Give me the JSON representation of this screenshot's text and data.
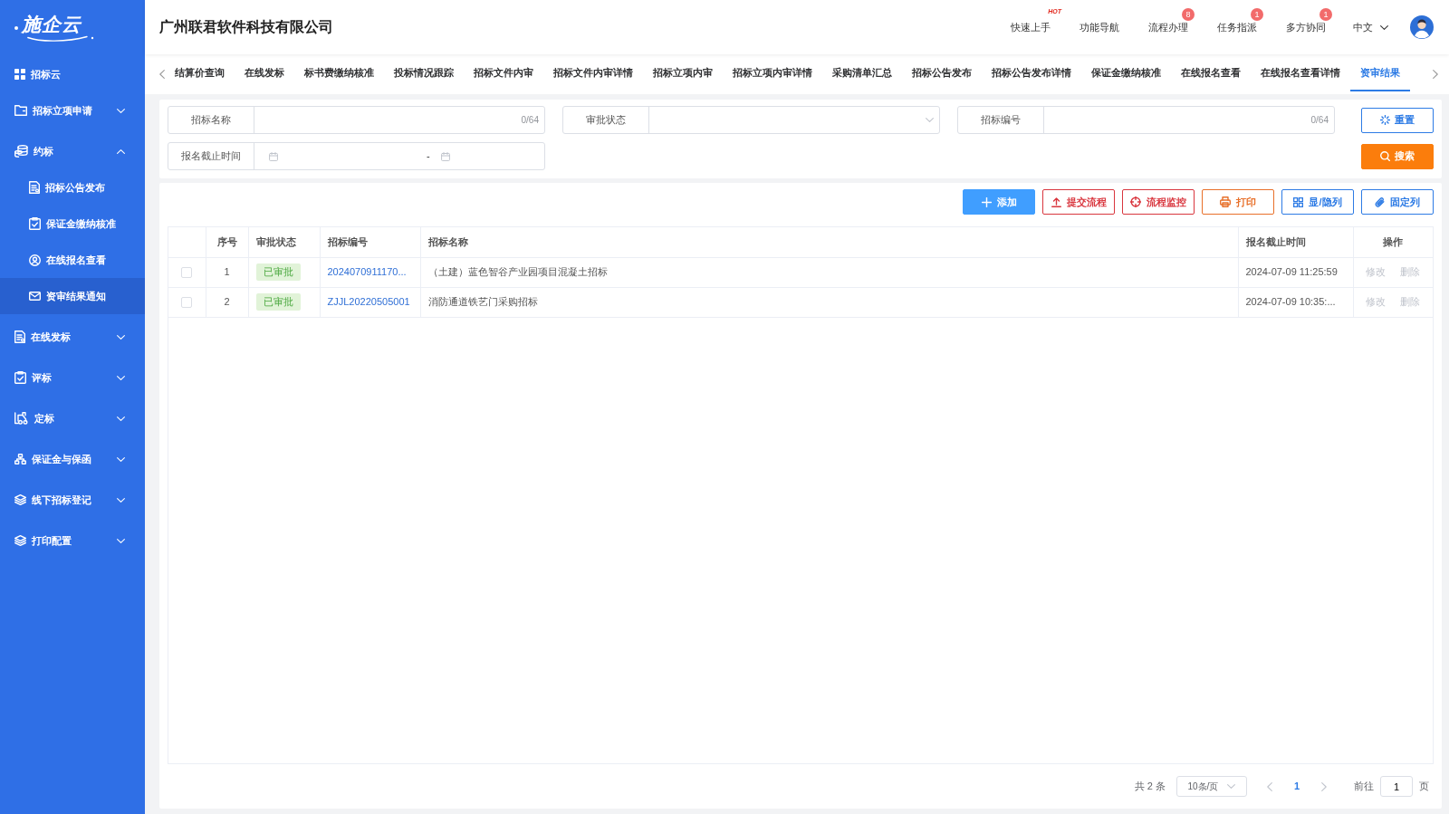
{
  "sidebar": {
    "logo": "施企云",
    "items": [
      {
        "label": "招标云",
        "selected": false
      },
      {
        "label": "招标立项申请",
        "expanded": false,
        "selected": false
      },
      {
        "label": "约标",
        "expanded": true,
        "selected": false,
        "children": [
          {
            "label": "招标公告发布",
            "selected": false
          },
          {
            "label": "保证金缴纳核准",
            "selected": false
          },
          {
            "label": "在线报名查看",
            "selected": false
          },
          {
            "label": "资审结果通知",
            "selected": true
          }
        ]
      },
      {
        "label": "在线发标",
        "expanded": false,
        "selected": false
      },
      {
        "label": "评标",
        "expanded": false,
        "selected": false
      },
      {
        "label": "定标",
        "expanded": false,
        "selected": false
      },
      {
        "label": "保证金与保函",
        "expanded": false,
        "selected": false
      },
      {
        "label": "线下招标登记",
        "expanded": false,
        "selected": false
      },
      {
        "label": "打印配置",
        "expanded": false,
        "selected": false
      }
    ]
  },
  "header": {
    "company": "广州联君软件科技有限公司",
    "nav": [
      {
        "label": "快速上手",
        "tag": "HOT"
      },
      {
        "label": "功能导航"
      },
      {
        "label": "流程办理",
        "badge": "8"
      },
      {
        "label": "任务指派",
        "badge": "1"
      },
      {
        "label": "多方协同",
        "badge": "1"
      }
    ],
    "language": "中文"
  },
  "tabs": [
    {
      "label": "结算价查询",
      "selected": false
    },
    {
      "label": "在线发标",
      "selected": false
    },
    {
      "label": "标书费缴纳核准",
      "selected": false
    },
    {
      "label": "投标情况跟踪",
      "selected": false
    },
    {
      "label": "招标文件内审",
      "selected": false
    },
    {
      "label": "招标文件内审详情",
      "selected": false
    },
    {
      "label": "招标立项内审",
      "selected": false
    },
    {
      "label": "招标立项内审详情",
      "selected": false
    },
    {
      "label": "采购清单汇总",
      "selected": false
    },
    {
      "label": "招标公告发布",
      "selected": false
    },
    {
      "label": "招标公告发布详情",
      "selected": false
    },
    {
      "label": "保证金缴纳核准",
      "selected": false
    },
    {
      "label": "在线报名查看",
      "selected": false
    },
    {
      "label": "在线报名查看详情",
      "selected": false
    },
    {
      "label": "资审结果",
      "selected": true
    }
  ],
  "filters": {
    "fields": [
      {
        "kind": "text",
        "label": "招标名称",
        "counter": "0/64"
      },
      {
        "kind": "select",
        "label": "审批状态"
      },
      {
        "kind": "text",
        "label": "招标编号",
        "counter": "0/64"
      },
      {
        "kind": "daterange",
        "label": "报名截止时间",
        "separator": "-"
      }
    ],
    "reset_button": "重置",
    "search_button": "搜索"
  },
  "toolbar": [
    {
      "kind": "primary",
      "label": "添加"
    },
    {
      "kind": "danger",
      "label": "提交流程"
    },
    {
      "kind": "danger",
      "label": "流程监控"
    },
    {
      "kind": "warning",
      "label": "打印"
    },
    {
      "kind": "info",
      "label": "显/隐列"
    },
    {
      "kind": "info",
      "label": "固定列"
    }
  ],
  "table": {
    "columns": [
      "序号",
      "审批状态",
      "招标编号",
      "招标名称",
      "报名截止时间",
      "操作"
    ],
    "rows": [
      {
        "checked": false,
        "no": "1",
        "status": "已审批",
        "code": "2024070911170...",
        "name": "（土建）蓝色智谷产业园项目混凝土招标",
        "deadline": "2024-07-09 11:25:59",
        "actions": [
          {
            "label": "修改",
            "disabled": true
          },
          {
            "label": "删除",
            "disabled": true
          }
        ]
      },
      {
        "checked": false,
        "no": "2",
        "status": "已审批",
        "code": "ZJJL20220505001",
        "name": "消防通道铁艺门采购招标",
        "deadline": "2024-07-09 10:35:...",
        "actions": [
          {
            "label": "修改",
            "disabled": true
          },
          {
            "label": "删除",
            "disabled": true
          }
        ]
      }
    ]
  },
  "pagination": {
    "total": "共 2 条",
    "page_size": "10条/页",
    "prev_disabled": true,
    "pages": [
      {
        "label": "1",
        "selected": true
      }
    ],
    "next_disabled": true,
    "goto_label": "前往",
    "goto_value": "1",
    "goto_suffix": "页"
  }
}
